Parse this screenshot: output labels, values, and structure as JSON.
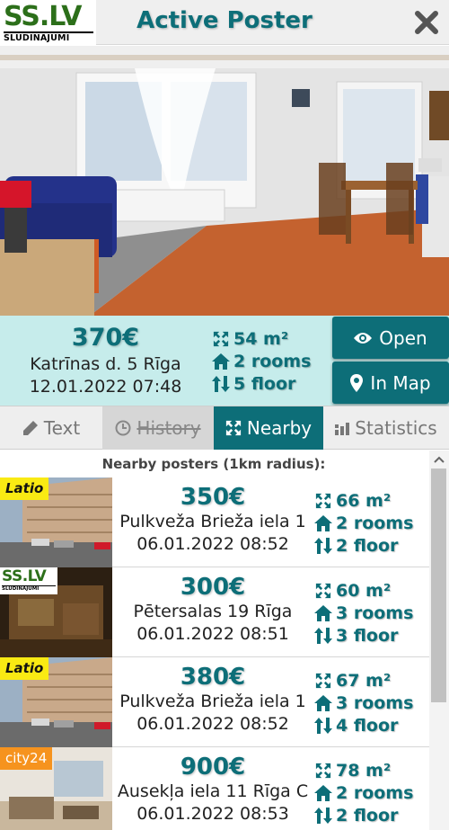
{
  "header": {
    "logo_main": "SS.LV",
    "logo_sub": "SLUDINĀJUMI",
    "title": "Active Poster",
    "close_icon": "close-icon"
  },
  "poster": {
    "price": "370€",
    "address": "Katrīnas d. 5 Rīga",
    "date": "12.01.2022 07:48",
    "area": "54 m²",
    "rooms": "2 rooms",
    "floor": "5 floor"
  },
  "actions": {
    "open_label": "Open",
    "map_label": "In Map"
  },
  "tabs": [
    {
      "label": "Text",
      "icon": "pencil-icon",
      "active": false,
      "disabled": false
    },
    {
      "label": "History",
      "icon": "clock-icon",
      "active": false,
      "disabled": true
    },
    {
      "label": "Nearby",
      "icon": "expand-icon",
      "active": true,
      "disabled": false
    },
    {
      "label": "Statistics",
      "icon": "bar-chart-icon",
      "active": false,
      "disabled": false
    }
  ],
  "nearby": {
    "heading": "Nearby posters (1km radius):",
    "items": [
      {
        "source": "Latio",
        "price": "350€",
        "address": "Pulkveža Brieža iela 1",
        "date": "06.01.2022 08:52",
        "area": "66 m²",
        "rooms": "2 rooms",
        "floor": "2 floor"
      },
      {
        "source": "SS.LV",
        "source_sub": "SLUDINĀJUMI",
        "price": "300€",
        "address": "Pētersalas 19 Rīga",
        "date": "06.01.2022 08:51",
        "area": "60 m²",
        "rooms": "3 rooms",
        "floor": "3 floor"
      },
      {
        "source": "Latio",
        "price": "380€",
        "address": "Pulkveža Brieža iela 1",
        "date": "06.01.2022 08:52",
        "area": "67 m²",
        "rooms": "3 rooms",
        "floor": "4 floor"
      },
      {
        "source": "city24",
        "price": "900€",
        "address": "Ausekļa iela 11 Rīga C",
        "date": "06.01.2022 08:53",
        "area": "78 m²",
        "rooms": "2 rooms",
        "floor": "2 floor"
      }
    ]
  },
  "colors": {
    "accent": "#0d6e78",
    "info_bg": "#c6eceb",
    "latio_badge": "#f9ea13",
    "city24_badge": "#f6931e",
    "sslv_green": "#2c6f1a"
  }
}
